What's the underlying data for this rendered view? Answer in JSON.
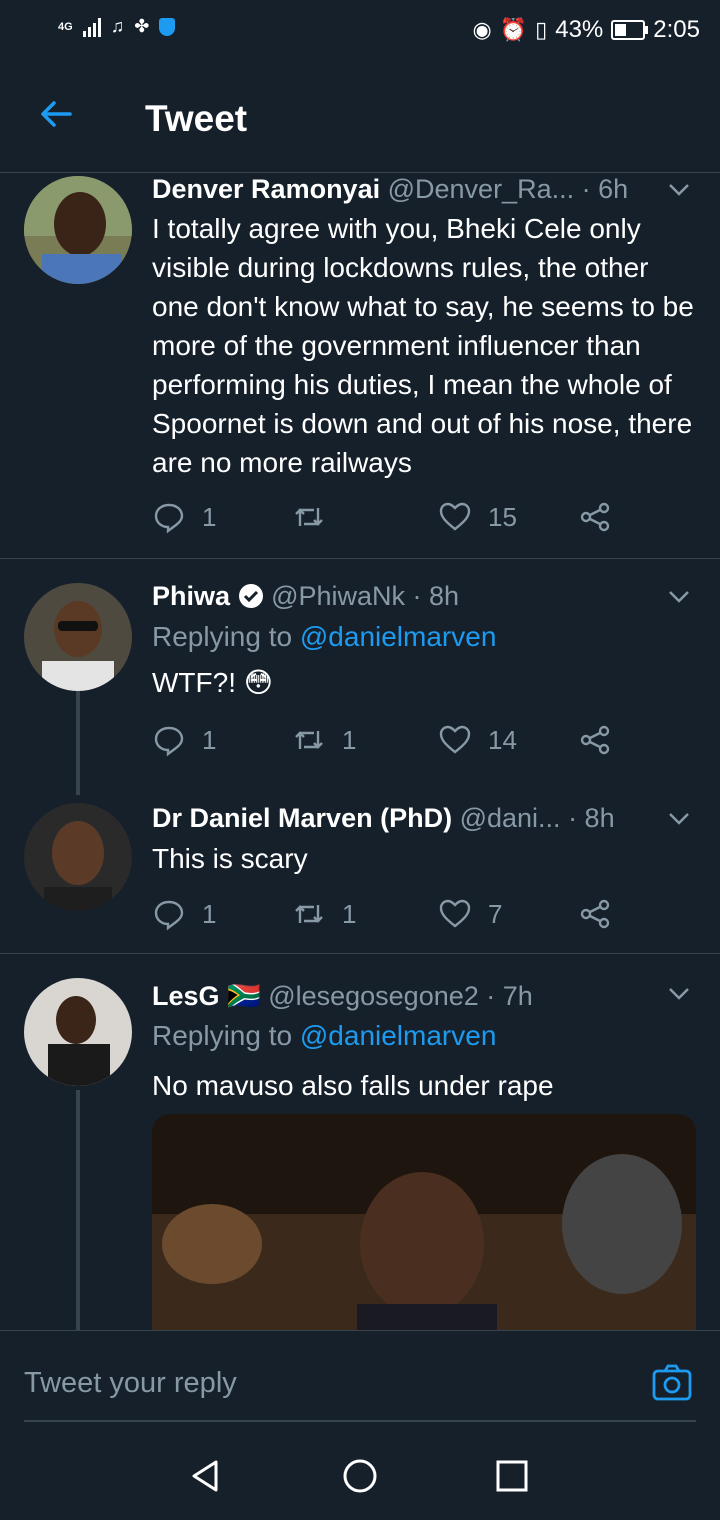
{
  "status_bar": {
    "network": "4G",
    "battery": "43%",
    "battery_level": 0.43,
    "time": "2:05"
  },
  "header": {
    "title": "Tweet"
  },
  "tweets": [
    {
      "name": "Denver Ramonyai",
      "handle": "@Denver_Ra...",
      "time": "· 6h",
      "text": "I totally agree with you, Bheki Cele only visible during lockdowns rules, the other one don't know what to say, he seems to be more of the government influencer than performing his duties, I mean the whole of Spoornet is down and out of his nose, there are no more railways",
      "replies": "1",
      "retweets": "",
      "likes": "15"
    },
    {
      "name": "Phiwa",
      "verified": true,
      "handle": "@PhiwaNk",
      "time": "· 8h",
      "replying_prefix": "Replying to ",
      "replying_to": "@danielmarven",
      "text": "WTF?! 😳",
      "replies": "1",
      "retweets": "1",
      "likes": "14"
    },
    {
      "name": "Dr Daniel Marven (PhD)",
      "handle": "@dani...",
      "time": "· 8h",
      "text": "This is scary",
      "replies": "1",
      "retweets": "1",
      "likes": "7"
    },
    {
      "name": "LesG",
      "flag": "🇿🇦",
      "handle": "@lesegosegone2",
      "time": "· 7h",
      "replying_prefix": "Replying to ",
      "replying_to": "@danielmarven",
      "text": "No mavuso also falls under rape"
    }
  ],
  "composer": {
    "placeholder": "Tweet your reply"
  },
  "colors": {
    "background": "#15202b",
    "accent": "#1d9bf0",
    "muted": "#8899a6",
    "divider": "#38444d"
  },
  "icons": [
    "back-arrow-icon",
    "chevron-down-icon",
    "reply-icon",
    "retweet-icon",
    "like-icon",
    "share-icon",
    "verified-icon",
    "camera-icon",
    "nav-back-icon",
    "nav-home-icon",
    "nav-recents-icon"
  ]
}
